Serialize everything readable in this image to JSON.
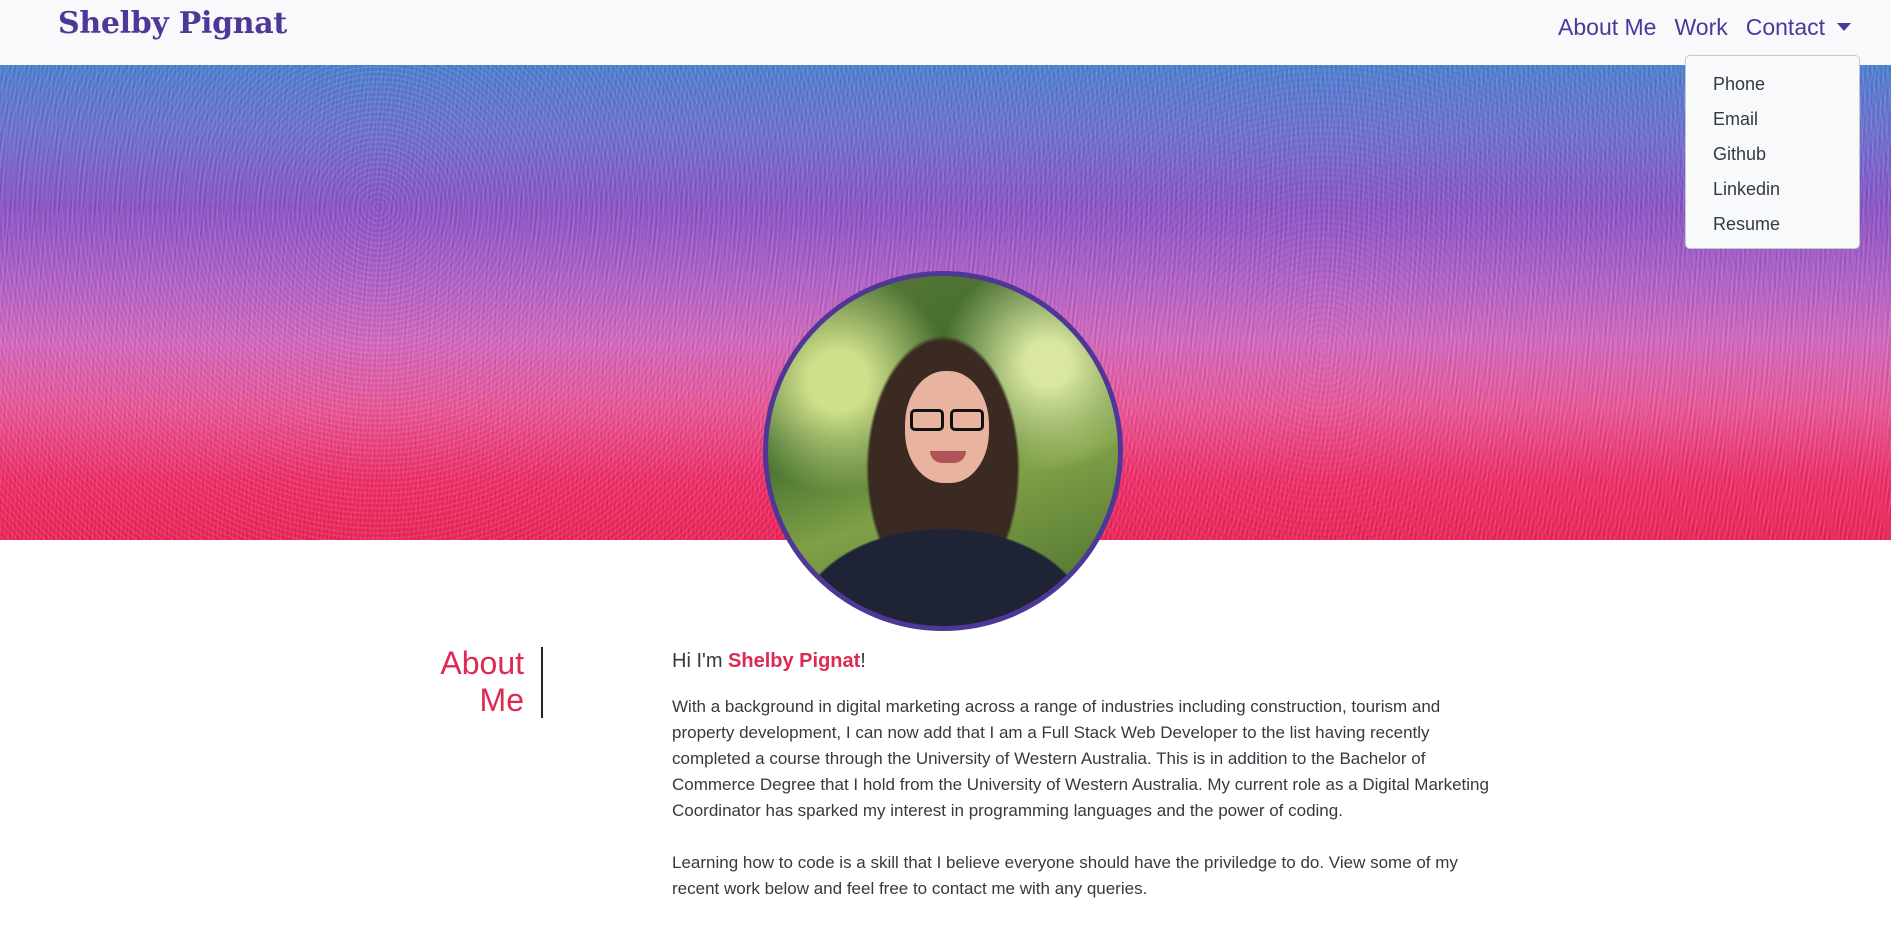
{
  "navbar": {
    "brand": "Shelby Pignat",
    "links": [
      "About Me",
      "Work",
      "Contact"
    ]
  },
  "dropdown": {
    "items": [
      "Phone",
      "Email",
      "Github",
      "Linkedin",
      "Resume"
    ]
  },
  "about": {
    "title_line1": "About",
    "title_line2": "Me",
    "greeting_prefix": "Hi I'm ",
    "greeting_name": "Shelby Pignat",
    "greeting_suffix": "!",
    "paragraph1": "With a background in digital marketing across a range of industries including construction, tourism and property development, I can now add that I am a Full Stack Web Developer to the list having recently completed a course through the University of Western Australia. This is in addition to the Bachelor of Commerce Degree that I hold from the University of Western Australia. My current role as a Digital Marketing Coordinator has sparked my interest in programming languages and the power of coding.",
    "paragraph2": "Learning how to code is a skill that I believe everyone should have the priviledge to do. View some of my recent work below and feel free to contact me with any queries."
  },
  "colors": {
    "brand": "#4f3797",
    "accent": "#dc2a52",
    "navbar_bg": "#f8f9fa"
  }
}
